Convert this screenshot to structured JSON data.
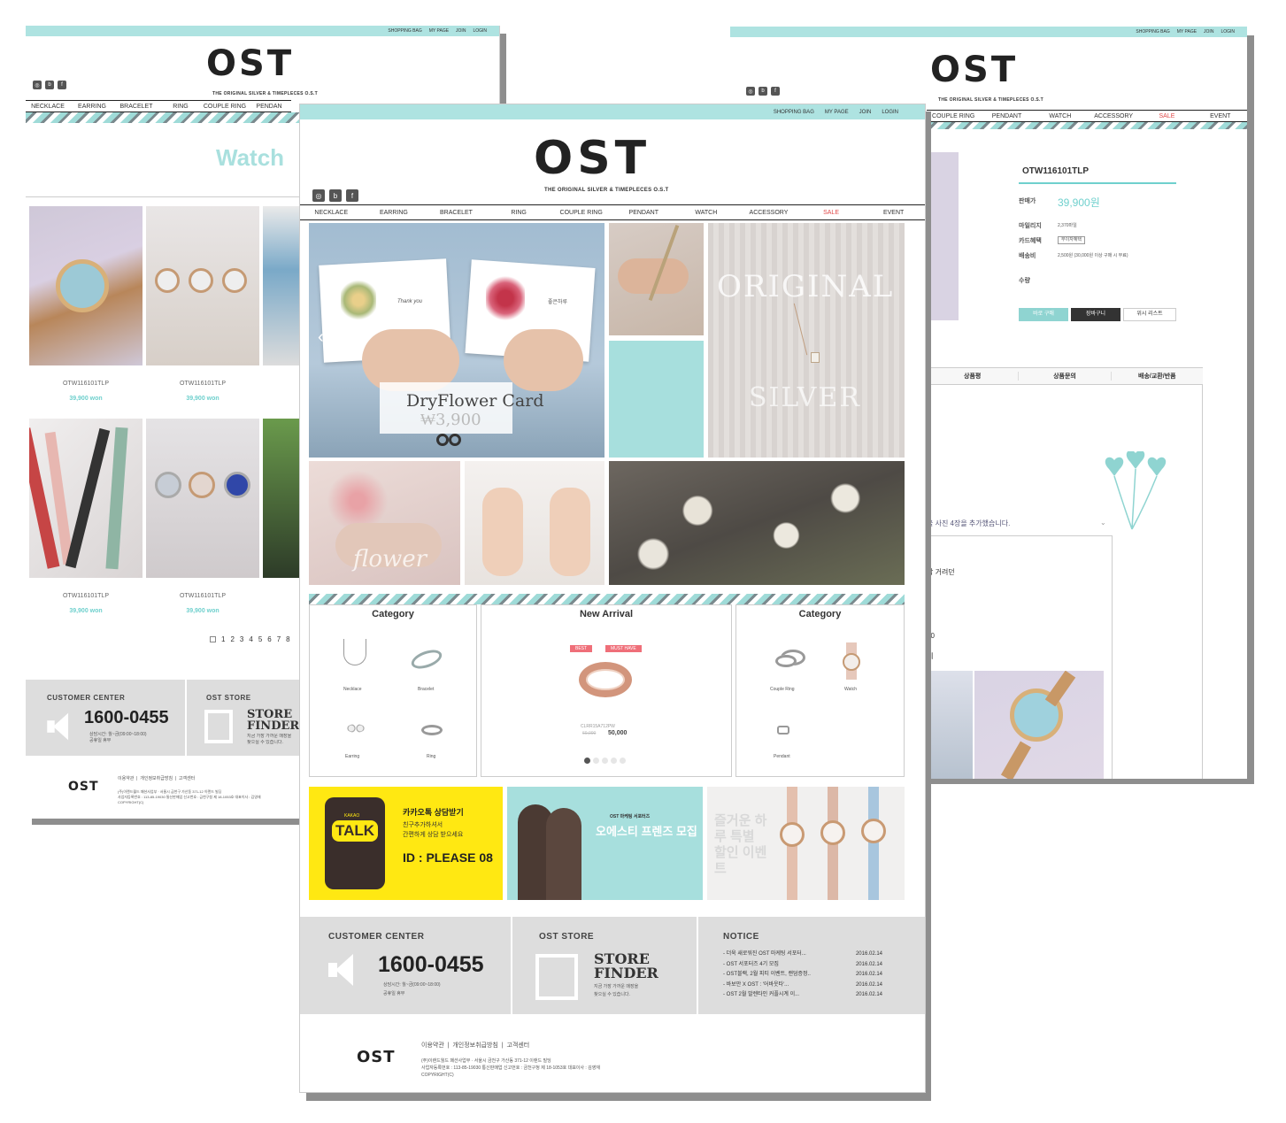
{
  "util_links": [
    "SHOPPING BAG",
    "MY PAGE",
    "JOIN",
    "LOGIN"
  ],
  "brand": {
    "logo": "OST",
    "tagline": "THE ORIGINAL SILVER & TIMEPLECES O.S.T"
  },
  "nav": {
    "left": [
      "NECKLACE",
      "EARRING",
      "BRACELET",
      "RING",
      "COUPLE RING",
      "PENDAN"
    ],
    "main": [
      "NECKLACE",
      "EARRING",
      "BRACELET",
      "RING",
      "COUPLE RING",
      "PENDANT",
      "WATCH",
      "ACCESSORY",
      "SALE",
      "EVENT"
    ],
    "right": [
      "COUPLE RING",
      "PENDANT",
      "WATCH",
      "ACCESSORY",
      "SALE",
      "EVENT"
    ]
  },
  "left_page": {
    "title": "Watch",
    "products": [
      {
        "code": "OTW116101TLP",
        "price": "39,900 won"
      },
      {
        "code": "OTW116101TLP",
        "price": "39,900 won"
      },
      {
        "code": "OTW116101TLP",
        "price": "39,900 won"
      },
      {
        "code": "OTW116101TLP",
        "price": "39,900 won"
      }
    ],
    "pagination": [
      "1",
      "2",
      "3",
      "4",
      "5",
      "6",
      "7",
      "8"
    ],
    "footer_links": "이용약관  |  개인정보취급방침  |  고객센터"
  },
  "hero": {
    "card_title": "DryFlower Card",
    "card_price": "₩3,900",
    "overlay_original": "ORIGINAL",
    "overlay_silver": "SILVER",
    "overlay_flower": "flower",
    "card_thanks": "Thank you",
    "card_korean": "좋은하루"
  },
  "boxes": {
    "category_left": {
      "title": "Category",
      "items": [
        "Necklace",
        "Bracelet",
        "Earring",
        "Ring"
      ]
    },
    "new_arrival": {
      "title": "New Arrival",
      "badge_best": "BEST",
      "badge_musthave": "MUST HAVE",
      "code": "CLRR15A712PW",
      "old_price": "60,000",
      "price": "50,000"
    },
    "category_right": {
      "title": "Category",
      "items": [
        "Couple Ring",
        "Watch",
        "Pendant"
      ]
    }
  },
  "banners": {
    "kakao": {
      "badge": "TALK",
      "small": "KAKAO",
      "line1": "카카오톡 상담받기",
      "line2": "친구추가하셔서",
      "line3": "간편하게 상담 받으세요",
      "id": "ID : PLEASE 08"
    },
    "friends": {
      "brand": "OST 마케팅 서포터즈",
      "title": "오에스티 프렌즈 모집"
    },
    "event": {
      "text": "즐거운 하루 특별 할인 이벤트"
    }
  },
  "footer": {
    "customer_center": {
      "title": "CUSTOMER CENTER",
      "phone": "1600-0455",
      "hours": "상담시간: 월~금(09:00~18:00)",
      "holiday": "공휴일 휴무"
    },
    "store": {
      "title": "OST STORE",
      "line1": "STORE",
      "line2": "FINDER",
      "desc1": "지금 가장 가까운 매장을",
      "desc2": "찾으실 수 있습니다."
    },
    "notice": {
      "title": "NOTICE",
      "items": [
        {
          "text": "- 더욱 새로워진 OST 마케팅 서포터...",
          "date": "2016.02.14"
        },
        {
          "text": "- OST 서포터즈 4기 모집",
          "date": "2016.02.14"
        },
        {
          "text": "- OST블랙, 2월 피티 이벤트, 랜덤증정..",
          "date": "2016.02.14"
        },
        {
          "text": "- 바보만 X OST : '어바웃타'...",
          "date": "2016.02.14"
        },
        {
          "text": "- OST 2월 발렌타인 커플시계 이...",
          "date": "2016.02.14"
        }
      ]
    },
    "links": "이용약관  |  개인정보취급방침  |  고객센터",
    "addr1": "(주)이랜드월드 패션사업부 · 서울시 금천구 가산동 371-12 이랜드 빌딩",
    "addr2": "사업자등록번호 : 113-85-19030 통신판매업 신고번호 : 금천구청 제 18-1053호 대표이사 : 김영재",
    "copyright": "COPYRIGHT(C)"
  },
  "right_page": {
    "code": "OTW116101TLP",
    "price_label": "판매가",
    "price": "39,900원",
    "mileage_label": "마일리지",
    "mileage": "2,370마일",
    "card_label": "카드혜택",
    "card_value": "무이자혜택",
    "ship_label": "배송비",
    "ship": "2,500원 (30,000원 이상 구매 시 무료)",
    "qty_label": "수량",
    "buttons": [
      "바로 구매",
      "장바구니",
      "위시 리스트"
    ],
    "tabs": [
      "상품평",
      "상품문의",
      "배송/교환/반품"
    ],
    "review_text": "을 사진 4장을 추가했습니다.",
    "snip1": "각 거려던",
    "snip2": "00",
    "snip3": "예"
  },
  "colors": {
    "mint": "#aee3e1",
    "sale": "#e04a4a",
    "accent": "#6fd0cd",
    "grey": "#dddddd"
  }
}
